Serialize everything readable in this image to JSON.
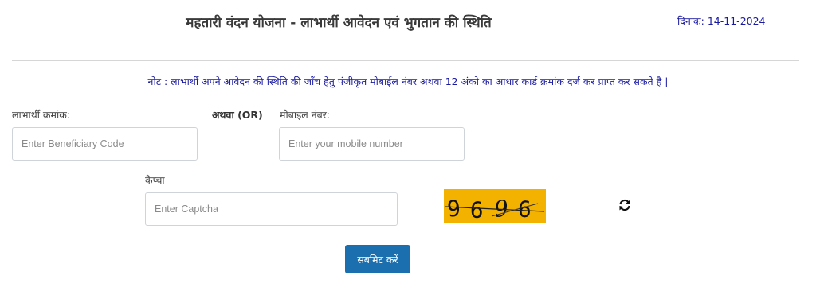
{
  "header": {
    "title": "महतारी वंदन योजना - लाभार्थी आवेदन एवं भुगतान की स्थिति",
    "date_label": "दिनांक:",
    "date_value": "14-11-2024"
  },
  "note": "नोट : लाभार्थी अपने आवेदन की स्थिति की जाँच हेतु पंजीकृत मोबाईल नंबर अथवा 12 अंको का आधार कार्ड क्रमांक दर्ज कर प्राप्त कर सकते है |",
  "form": {
    "beneficiary_label": "लाभार्थी क्रमांक:",
    "beneficiary_placeholder": "Enter Beneficiary Code",
    "beneficiary_value": "",
    "or_label": "अथवा (OR)",
    "mobile_label": "मोबाइल नंबर:",
    "mobile_placeholder": "Enter your mobile number",
    "mobile_value": "",
    "captcha_label": "कैप्चा",
    "captcha_placeholder": "Enter Captcha",
    "captcha_value": "",
    "captcha_code": [
      "9",
      "6",
      "9",
      "6"
    ],
    "refresh_icon": "refresh-icon",
    "submit_label": "सबमिट करें"
  },
  "colors": {
    "accent_blue": "#1c6fae",
    "note_text": "#1a1aa0",
    "captcha_bg": "#f3b100"
  }
}
